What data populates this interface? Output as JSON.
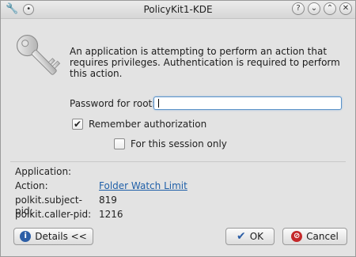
{
  "window": {
    "title": "PolicyKit1-KDE"
  },
  "titlebar_buttons": {
    "help": "?",
    "minimize": "⌄",
    "maximize": "⌃",
    "close": "✕"
  },
  "message": "An application is attempting to perform an action that requires privileges. Authentication is required to perform this action.",
  "password": {
    "label": "Password for root:",
    "value": ""
  },
  "remember": {
    "label": "Remember authorization",
    "checked": true
  },
  "session_only": {
    "label": "For this session only",
    "checked": false
  },
  "details": {
    "application_label": "Application:",
    "action_label": "Action:",
    "action_value": "Folder Watch Limit",
    "subject_pid_label": "polkit.subject-pid:",
    "subject_pid_value": "819",
    "caller_pid_label": "polkit.caller-pid:",
    "caller_pid_value": "1216"
  },
  "buttons": {
    "details": "Details <<",
    "ok": "OK",
    "cancel": "Cancel"
  },
  "icons": {
    "window_menu": "wrench-icon",
    "sticky": "pin-icon",
    "key": "key-icon",
    "details": "info-icon",
    "ok": "checkmark-icon",
    "cancel": "cancel-icon"
  },
  "colors": {
    "link": "#1f5fa8",
    "focus": "#5a92c9",
    "cancel": "#c4282a",
    "info": "#2c5ea6"
  }
}
